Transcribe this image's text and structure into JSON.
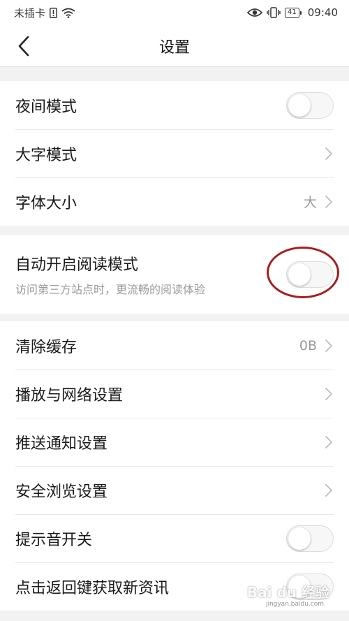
{
  "status_bar": {
    "carrier": "未插卡",
    "time": "09:40",
    "battery": "41",
    "icons": [
      "sim-alert-icon",
      "wifi-icon",
      "eye-icon",
      "vibrate-icon",
      "battery-icon"
    ]
  },
  "header": {
    "title": "设置",
    "back_icon": "chevron-left-icon"
  },
  "group1": {
    "night_mode": {
      "label": "夜间模式",
      "enabled": false
    },
    "large_text_mode": {
      "label": "大字模式"
    },
    "font_size": {
      "label": "字体大小",
      "value": "大"
    }
  },
  "group2": {
    "auto_reading_mode": {
      "label": "自动开启阅读模式",
      "description": "访问第三方站点时，更流畅的阅读体验",
      "enabled": false
    }
  },
  "group3": {
    "clear_cache": {
      "label": "清除缓存",
      "value": "0B"
    },
    "playback_network": {
      "label": "播放与网络设置"
    },
    "push_notifications": {
      "label": "推送通知设置"
    },
    "safe_browsing": {
      "label": "安全浏览设置"
    },
    "notification_sound": {
      "label": "提示音开关",
      "enabled": false
    },
    "back_key_refresh": {
      "label": "点击返回键获取新资讯",
      "enabled": false
    }
  },
  "colors": {
    "highlight": "#a81d1d",
    "background": "#f2f2f2",
    "secondary_text": "#9a9a9a"
  },
  "watermark": {
    "text": "Bai du 经验",
    "sub": "jingyan.baidu.com"
  }
}
